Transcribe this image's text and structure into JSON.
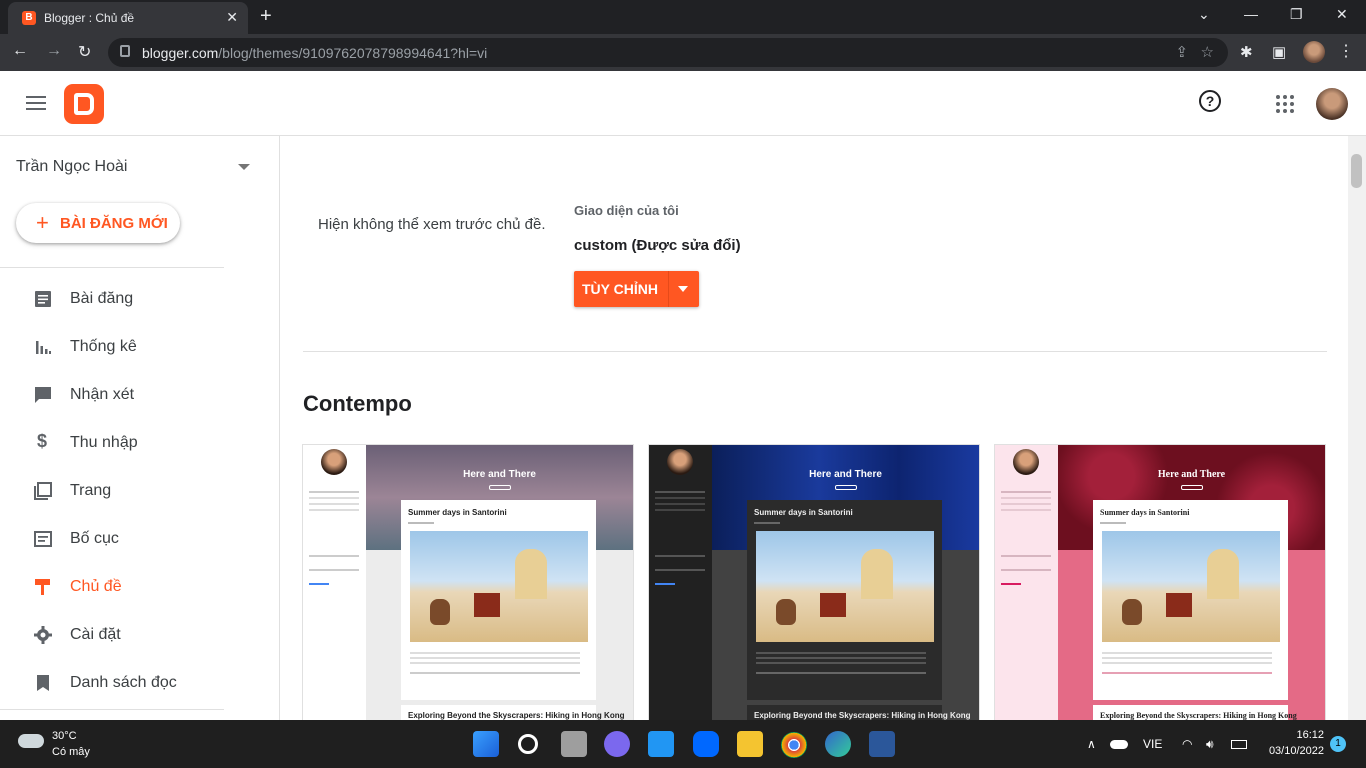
{
  "browser": {
    "tab_title": "Blogger : Chủ đề",
    "tab_favicon": "B",
    "url_host": "blogger.com",
    "url_path": "/blog/themes/9109762078798994641?hl=vi"
  },
  "sidebar": {
    "blog_name": "Trần Ngọc Hoài",
    "new_post_label": "BÀI ĐĂNG MỚI",
    "items": [
      {
        "label": "Bài đăng",
        "icon": "posts-icon"
      },
      {
        "label": "Thống kê",
        "icon": "stats-icon"
      },
      {
        "label": "Nhận xét",
        "icon": "comments-icon"
      },
      {
        "label": "Thu nhập",
        "icon": "dollar-icon"
      },
      {
        "label": "Trang",
        "icon": "pages-icon"
      },
      {
        "label": "Bố cục",
        "icon": "layout-icon"
      },
      {
        "label": "Chủ đề",
        "icon": "theme-icon",
        "active": true
      },
      {
        "label": "Cài đặt",
        "icon": "gear-icon"
      },
      {
        "label": "Danh sách đọc",
        "icon": "bookmark-icon"
      }
    ]
  },
  "main": {
    "no_preview_text": "Hiện không thể xem trước chủ đề.",
    "my_theme_label": "Giao diện của tôi",
    "theme_name": "custom (Được sửa đổi)",
    "customize_label": "TÙY CHỈNH",
    "section_title": "Contempo",
    "cards": [
      {
        "hero_title": "Here and There",
        "post_title": "Summer days in Santorini",
        "post2_title": "Exploring Beyond the Skyscrapers: Hiking in Hong Kong",
        "variant": "light"
      },
      {
        "hero_title": "Here and There",
        "post_title": "Summer days in Santorini",
        "post2_title": "Exploring Beyond the Skyscrapers: Hiking in Hong Kong",
        "variant": "dark"
      },
      {
        "hero_title": "Here and There",
        "post_title": "Summer days in Santorini",
        "post2_title": "Exploring Beyond the Skyscrapers: Hiking in Hong Kong",
        "variant": "pink"
      }
    ]
  },
  "taskbar": {
    "temperature": "30°C",
    "condition": "Có mây",
    "language": "VIE",
    "time": "16:12",
    "date": "03/10/2022",
    "notifications": "1"
  },
  "colors": {
    "accent": "#ff5722",
    "active_nav": "#ff5722"
  }
}
